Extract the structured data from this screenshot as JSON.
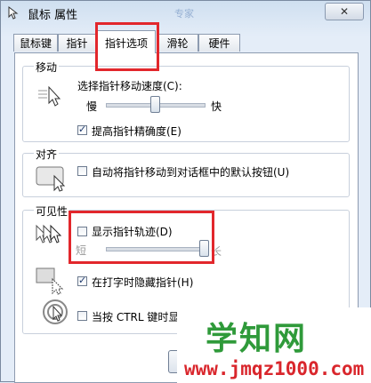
{
  "window": {
    "title": "鼠标 属性",
    "bg_text": "专家",
    "close_symbol": "✕"
  },
  "tabs": [
    {
      "label": "鼠标键"
    },
    {
      "label": "指针"
    },
    {
      "label": "指针选项"
    },
    {
      "label": "滑轮"
    },
    {
      "label": "硬件"
    }
  ],
  "motion": {
    "title": "移动",
    "speed_label": "选择指针移动速度(C):",
    "slow": "慢",
    "fast": "快",
    "speed_level": 0.5,
    "precision_label": "提高指针精确度(E)",
    "precision_checked": true
  },
  "snap": {
    "title": "对齐",
    "label": "自动将指针移动到对话框中的默认按钮(U)",
    "checked": false
  },
  "visibility": {
    "title": "可见性",
    "trails_label": "显示指针轨迹(D)",
    "trails_checked": false,
    "short": "短",
    "long": "长",
    "trails_level": 1.0,
    "hide_label": "在打字时隐藏指针(H)",
    "hide_checked": true,
    "ctrl_label": "当按 CTRL 键时显示"
  },
  "buttons": {
    "ok": "确"
  },
  "watermark": {
    "main": "学知网",
    "url": "www.jmqz1000.com"
  },
  "colors": {
    "highlight": "#e2272c",
    "watermark_green": "#2f9a3a",
    "watermark_red": "#d9262c"
  }
}
